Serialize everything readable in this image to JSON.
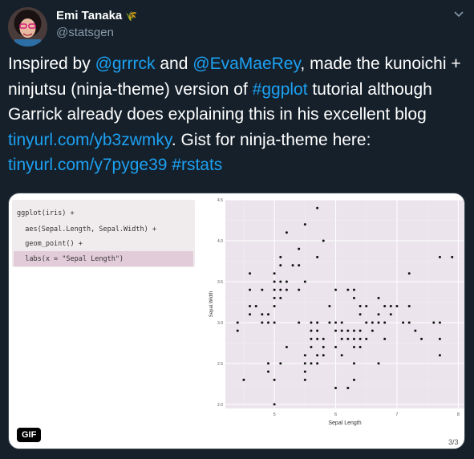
{
  "author": {
    "name": "Emi Tanaka",
    "emoji": "🌾",
    "handle": "@statsgen"
  },
  "tweet": {
    "p1": "Inspired by ",
    "m1": "@grrrck",
    "p2": " and ",
    "m2": "@EvaMaeRey",
    "p3": ", made the kunoichi + ninjutsu (ninja-theme) version of ",
    "h1": "#ggplot",
    "p4": " tutorial although Garrick already does explaining this in his excellent blog ",
    "l1": "tinyurl.com/yb3zwmky",
    "p5": ". Gist for ninja-theme here: ",
    "l2": "tinyurl.com/y7pyge39",
    "p6": " ",
    "h2": "#rstats"
  },
  "code": {
    "line1": "ggplot(iris) +",
    "line2": "  aes(Sepal.Length, Sepal.Width) +",
    "line3": "  geom_point() +",
    "line4": "  labs(x = \"Sepal Length\")"
  },
  "chart_data": {
    "type": "scatter",
    "xlabel": "Sepal Length",
    "ylabel": "Sepal.Width",
    "xlim": [
      4.2,
      8.1
    ],
    "ylim": [
      1.95,
      4.5
    ],
    "x_ticks": [
      "5",
      "6",
      "7",
      "8"
    ],
    "y_ticks": [
      "2.0",
      "2.5",
      "3.0",
      "3.5",
      "4.0",
      "4.5"
    ],
    "grid": true,
    "points": [
      [
        4.4,
        3.0
      ],
      [
        4.4,
        2.9
      ],
      [
        4.5,
        2.3
      ],
      [
        4.6,
        3.1
      ],
      [
        4.6,
        3.4
      ],
      [
        4.6,
        3.6
      ],
      [
        4.6,
        3.2
      ],
      [
        4.7,
        3.2
      ],
      [
        4.8,
        3.4
      ],
      [
        4.8,
        3.0
      ],
      [
        4.8,
        3.1
      ],
      [
        4.9,
        3.0
      ],
      [
        4.9,
        3.1
      ],
      [
        4.9,
        2.4
      ],
      [
        4.9,
        2.5
      ],
      [
        5.0,
        3.6
      ],
      [
        5.0,
        3.4
      ],
      [
        5.0,
        3.0
      ],
      [
        5.0,
        3.3
      ],
      [
        5.0,
        3.5
      ],
      [
        5.0,
        3.2
      ],
      [
        5.0,
        2.0
      ],
      [
        5.0,
        2.3
      ],
      [
        5.1,
        3.5
      ],
      [
        5.1,
        3.8
      ],
      [
        5.1,
        3.7
      ],
      [
        5.1,
        3.3
      ],
      [
        5.1,
        3.4
      ],
      [
        5.1,
        2.5
      ],
      [
        5.2,
        3.5
      ],
      [
        5.2,
        3.4
      ],
      [
        5.2,
        4.1
      ],
      [
        5.2,
        2.7
      ],
      [
        5.3,
        3.7
      ],
      [
        5.4,
        3.9
      ],
      [
        5.4,
        3.7
      ],
      [
        5.4,
        3.4
      ],
      [
        5.4,
        3.0
      ],
      [
        5.5,
        4.2
      ],
      [
        5.5,
        3.5
      ],
      [
        5.5,
        2.3
      ],
      [
        5.5,
        2.4
      ],
      [
        5.5,
        2.6
      ],
      [
        5.5,
        2.5
      ],
      [
        5.6,
        2.9
      ],
      [
        5.6,
        3.0
      ],
      [
        5.6,
        2.5
      ],
      [
        5.6,
        2.8
      ],
      [
        5.6,
        2.7
      ],
      [
        5.7,
        4.4
      ],
      [
        5.7,
        3.8
      ],
      [
        5.7,
        2.8
      ],
      [
        5.7,
        2.6
      ],
      [
        5.7,
        3.0
      ],
      [
        5.7,
        2.9
      ],
      [
        5.7,
        2.5
      ],
      [
        5.8,
        4.0
      ],
      [
        5.8,
        2.7
      ],
      [
        5.8,
        2.6
      ],
      [
        5.8,
        2.8
      ],
      [
        5.9,
        3.0
      ],
      [
        5.9,
        3.2
      ],
      [
        6.0,
        2.2
      ],
      [
        6.0,
        2.9
      ],
      [
        6.0,
        2.7
      ],
      [
        6.0,
        3.4
      ],
      [
        6.0,
        3.0
      ],
      [
        6.1,
        2.8
      ],
      [
        6.1,
        3.0
      ],
      [
        6.1,
        2.6
      ],
      [
        6.1,
        2.9
      ],
      [
        6.2,
        2.2
      ],
      [
        6.2,
        2.9
      ],
      [
        6.2,
        2.8
      ],
      [
        6.2,
        3.4
      ],
      [
        6.3,
        3.3
      ],
      [
        6.3,
        2.5
      ],
      [
        6.3,
        2.3
      ],
      [
        6.3,
        2.7
      ],
      [
        6.3,
        2.9
      ],
      [
        6.3,
        2.8
      ],
      [
        6.3,
        3.4
      ],
      [
        6.4,
        3.2
      ],
      [
        6.4,
        2.9
      ],
      [
        6.4,
        2.7
      ],
      [
        6.4,
        2.8
      ],
      [
        6.4,
        3.1
      ],
      [
        6.5,
        2.8
      ],
      [
        6.5,
        3.0
      ],
      [
        6.5,
        3.2
      ],
      [
        6.6,
        2.9
      ],
      [
        6.6,
        3.0
      ],
      [
        6.7,
        3.1
      ],
      [
        6.7,
        3.0
      ],
      [
        6.7,
        2.5
      ],
      [
        6.7,
        3.3
      ],
      [
        6.8,
        2.8
      ],
      [
        6.8,
        3.0
      ],
      [
        6.8,
        3.2
      ],
      [
        6.9,
        3.1
      ],
      [
        6.9,
        3.2
      ],
      [
        7.0,
        3.2
      ],
      [
        7.1,
        3.0
      ],
      [
        7.2,
        3.6
      ],
      [
        7.2,
        3.2
      ],
      [
        7.2,
        3.0
      ],
      [
        7.3,
        2.9
      ],
      [
        7.4,
        2.8
      ],
      [
        7.6,
        3.0
      ],
      [
        7.7,
        3.8
      ],
      [
        7.7,
        2.6
      ],
      [
        7.7,
        2.8
      ],
      [
        7.7,
        3.0
      ],
      [
        7.9,
        3.8
      ]
    ]
  },
  "media": {
    "badge": "GIF",
    "counter": "3/3"
  }
}
